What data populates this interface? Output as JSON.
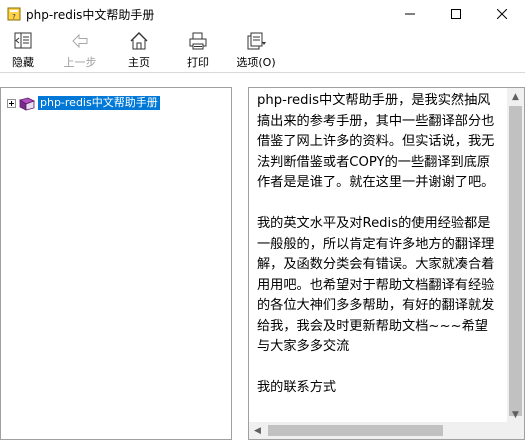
{
  "window": {
    "title": "php-redis中文帮助手册",
    "minimize_icon": "minimize-icon",
    "maximize_icon": "maximize-icon",
    "close_icon": "close-icon"
  },
  "toolbar": {
    "hide_label": "隐藏",
    "back_label": "上一步",
    "home_label": "主页",
    "print_label": "打印",
    "options_label": "选项(O)"
  },
  "tree": {
    "items": [
      {
        "label": "php-redis中文帮助手册",
        "selected": true,
        "icon": "book-icon"
      }
    ]
  },
  "content": {
    "paragraphs": [
      "php-redis中文帮助手册，是我实然抽风搞出来的参考手册，其中一些翻译部分也借鉴了网上许多的资料。但实话说，我无法判断借鉴或者COPY的一些翻译到底原作者是是谁了。就在这里一并谢谢了吧。",
      "我的英文水平及对Redis的使用经验都是一般般的，所以肯定有许多地方的翻译理解，及函数分类会有错误。大家就凑合着用用吧。也希望对于帮助文档翻译有经验的各位大神们多多帮助，有好的翻译就发给我，我会及时更新帮助文档~~~希望与大家多多交流",
      "我的联系方式"
    ]
  },
  "colors": {
    "selection": "#0078d7",
    "scrollbar_thumb": "#c1c1c1",
    "scrollbar_track": "#f0f0f0"
  }
}
